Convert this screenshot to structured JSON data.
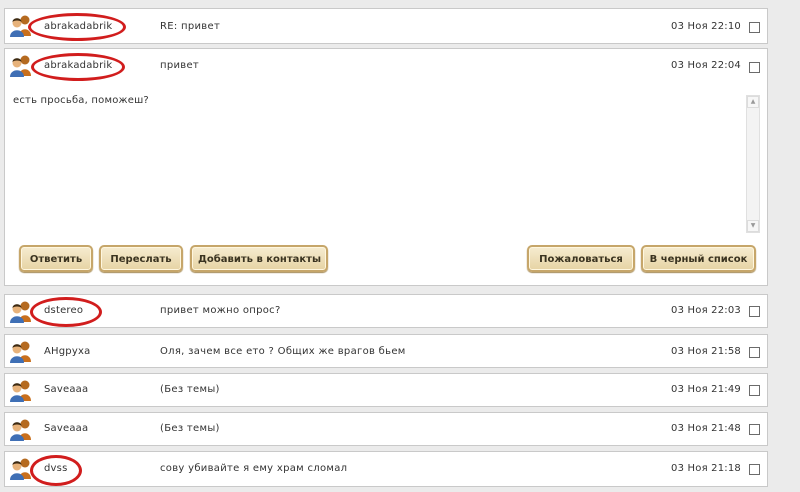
{
  "messages": [
    {
      "sender": "abrakadabrik",
      "subject": "RE: привет",
      "date": "03 Ноя 22:10"
    },
    {
      "sender": "abrakadabrik",
      "subject": "привет",
      "date": "03 Ноя 22:04",
      "body": "есть просьба, поможеш?"
    },
    {
      "sender": "dstereo",
      "subject": "привет можно опрос?",
      "date": "03 Ноя 22:03"
    },
    {
      "sender": "AHgpyxa",
      "subject": "Оля, зачем все ето ? Общих же врагов бьем",
      "date": "03 Ноя 21:58"
    },
    {
      "sender": "Saveaaa",
      "subject": "(Без темы)",
      "date": "03 Ноя 21:49"
    },
    {
      "sender": "Saveaaa",
      "subject": "(Без темы)",
      "date": "03 Ноя 21:48"
    },
    {
      "sender": "dvss",
      "subject": "сову убивайте я ему храм сломал",
      "date": "03 Ноя 21:18"
    }
  ],
  "actions": {
    "reply": "Ответить",
    "forward": "Переслать",
    "add_contact": "Добавить в контакты",
    "complain": "Пожаловаться",
    "blacklist": "В черный список"
  },
  "colors": {
    "highlight": "#d11d1d",
    "button_border": "#c6a66a"
  }
}
